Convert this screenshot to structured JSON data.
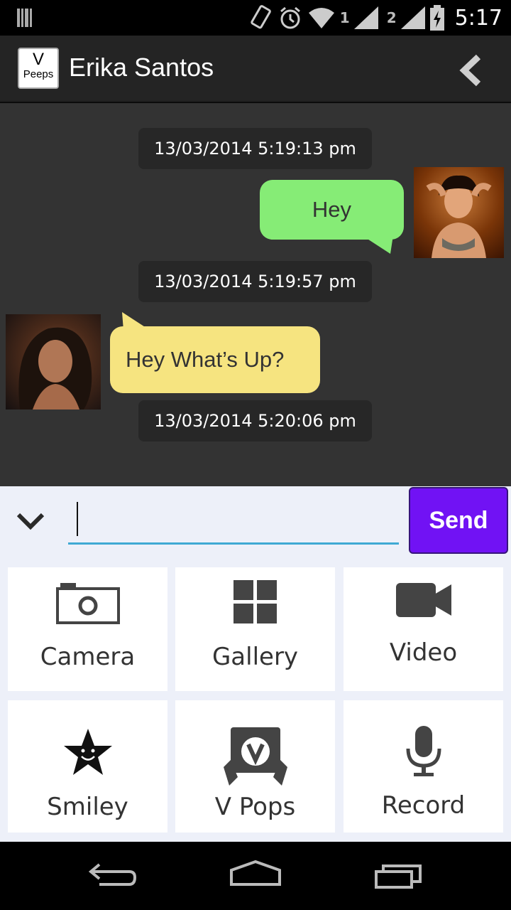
{
  "status_bar": {
    "time": "5:17",
    "sim1_label": "1",
    "sim2_label": "2",
    "icons": [
      "barcode-icon",
      "rotation-icon",
      "alarm-icon",
      "wifi-icon",
      "signal-icon",
      "battery-charging-icon"
    ]
  },
  "header": {
    "logo_line1": "V",
    "logo_line2": "Peeps",
    "contact_name": "Erika Santos",
    "back_icon": "chevron-left-icon"
  },
  "messages": [
    {
      "timestamp": "13/03/2014 5:19:13 pm",
      "text": "Hey",
      "direction": "outgoing"
    },
    {
      "timestamp": "13/03/2014 5:19:57 pm",
      "text": "Hey What’s Up?",
      "direction": "incoming"
    },
    {
      "timestamp": "13/03/2014 5:20:06 pm"
    }
  ],
  "composer": {
    "input_value": "",
    "send_label": "Send",
    "collapse_icon": "chevron-down-icon"
  },
  "attachments": [
    {
      "label": "Camera",
      "icon": "camera-icon"
    },
    {
      "label": "Gallery",
      "icon": "gallery-grid-icon"
    },
    {
      "label": "Video",
      "icon": "video-camera-icon"
    },
    {
      "label": "Smiley",
      "icon": "smiley-star-icon"
    },
    {
      "label": "V Pops",
      "icon": "vpops-icon"
    },
    {
      "label": "Record",
      "icon": "microphone-icon"
    }
  ],
  "colors": {
    "outgoing_bubble": "#86ec76",
    "incoming_bubble": "#f6e480",
    "send_button": "#7112f4",
    "input_underline": "#3fa9d4"
  }
}
